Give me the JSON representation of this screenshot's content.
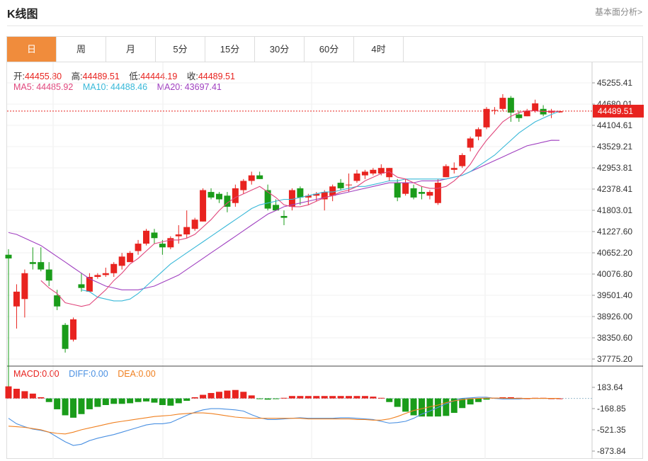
{
  "header": {
    "title": "K线图",
    "link": "基本面分析>"
  },
  "tabs": [
    {
      "label": "日",
      "active": true
    },
    {
      "label": "周",
      "active": false
    },
    {
      "label": "月",
      "active": false
    },
    {
      "label": "5分",
      "active": false
    },
    {
      "label": "15分",
      "active": false
    },
    {
      "label": "30分",
      "active": false
    },
    {
      "label": "60分",
      "active": false
    },
    {
      "label": "4时",
      "active": false
    }
  ],
  "ohlc_info": {
    "open_label": "开:",
    "open": "44455.80",
    "high_label": "高:",
    "high": "44489.51",
    "low_label": "低:",
    "low": "44444.19",
    "close_label": "收:",
    "close": "44489.51"
  },
  "ma_info": {
    "ma5_label": "MA5:",
    "ma5": "44485.92",
    "ma10_label": "MA10:",
    "ma10": "44488.46",
    "ma20_label": "MA20:",
    "ma20": "43697.41"
  },
  "macd_info": {
    "macd_label": "MACD:",
    "macd": "0.00",
    "diff_label": "DIFF:",
    "diff": "0.00",
    "dea_label": "DEA:",
    "dea": "0.00"
  },
  "current_price_tag": "44489.51",
  "colors": {
    "up": "#e8231f",
    "down": "#1a9c1a",
    "ma5": "#e0467c",
    "ma10": "#38b8d8",
    "ma20": "#a040c0",
    "dea": "#f08020",
    "diff": "#4a90e2",
    "accent": "#f08c3c"
  },
  "chart_data": {
    "type": "candlestick",
    "y_ticks": [
      "45255.41",
      "44680.01",
      "44104.61",
      "43529.21",
      "42953.81",
      "42378.41",
      "41803.01",
      "41227.60",
      "40652.20",
      "40076.80",
      "39501.40",
      "38926.00",
      "38350.60",
      "37775.20"
    ],
    "ylim": [
      37775.2,
      45255.41
    ],
    "candles": [
      {
        "o": 40600,
        "h": 40750,
        "l": 37000,
        "c": 40500
      },
      {
        "o": 39200,
        "h": 39800,
        "l": 38600,
        "c": 39600
      },
      {
        "o": 39400,
        "h": 40200,
        "l": 38900,
        "c": 40100
      },
      {
        "o": 40400,
        "h": 40800,
        "l": 40200,
        "c": 40350
      },
      {
        "o": 40400,
        "h": 40800,
        "l": 40150,
        "c": 40200
      },
      {
        "o": 40200,
        "h": 40400,
        "l": 39750,
        "c": 39900
      },
      {
        "o": 39500,
        "h": 39650,
        "l": 39100,
        "c": 39200
      },
      {
        "o": 38700,
        "h": 38750,
        "l": 37950,
        "c": 38050
      },
      {
        "o": 38300,
        "h": 38900,
        "l": 38250,
        "c": 38850
      },
      {
        "o": 39800,
        "h": 40100,
        "l": 39600,
        "c": 39700
      },
      {
        "o": 39600,
        "h": 40100,
        "l": 39600,
        "c": 40000
      },
      {
        "o": 40000,
        "h": 40100,
        "l": 39950,
        "c": 40050
      },
      {
        "o": 40050,
        "h": 40250,
        "l": 40000,
        "c": 40100
      },
      {
        "o": 40100,
        "h": 40400,
        "l": 40000,
        "c": 40350
      },
      {
        "o": 40300,
        "h": 40650,
        "l": 40200,
        "c": 40550
      },
      {
        "o": 40400,
        "h": 40700,
        "l": 40400,
        "c": 40650
      },
      {
        "o": 40700,
        "h": 41000,
        "l": 40600,
        "c": 40900
      },
      {
        "o": 40900,
        "h": 41300,
        "l": 40850,
        "c": 41250
      },
      {
        "o": 41200,
        "h": 41300,
        "l": 40900,
        "c": 41050
      },
      {
        "o": 40900,
        "h": 41000,
        "l": 40600,
        "c": 40800
      },
      {
        "o": 40800,
        "h": 41100,
        "l": 40750,
        "c": 41050
      },
      {
        "o": 41100,
        "h": 41400,
        "l": 40900,
        "c": 41150
      },
      {
        "o": 41150,
        "h": 41800,
        "l": 41050,
        "c": 41350
      },
      {
        "o": 41300,
        "h": 41600,
        "l": 41250,
        "c": 41550
      },
      {
        "o": 41500,
        "h": 42400,
        "l": 41500,
        "c": 42350
      },
      {
        "o": 42300,
        "h": 42400,
        "l": 42100,
        "c": 42150
      },
      {
        "o": 42250,
        "h": 42300,
        "l": 42000,
        "c": 42100
      },
      {
        "o": 42200,
        "h": 42300,
        "l": 41750,
        "c": 41900
      },
      {
        "o": 42000,
        "h": 42500,
        "l": 41900,
        "c": 42400
      },
      {
        "o": 42350,
        "h": 42650,
        "l": 42250,
        "c": 42600
      },
      {
        "o": 42600,
        "h": 42850,
        "l": 42500,
        "c": 42750
      },
      {
        "o": 42750,
        "h": 42850,
        "l": 42650,
        "c": 42650
      },
      {
        "o": 42350,
        "h": 42500,
        "l": 41800,
        "c": 41850
      },
      {
        "o": 41950,
        "h": 42100,
        "l": 41800,
        "c": 41800
      },
      {
        "o": 41650,
        "h": 41800,
        "l": 41400,
        "c": 41600
      },
      {
        "o": 41900,
        "h": 42400,
        "l": 41800,
        "c": 42350
      },
      {
        "o": 42400,
        "h": 42450,
        "l": 41950,
        "c": 42150
      },
      {
        "o": 42150,
        "h": 42250,
        "l": 41950,
        "c": 42200
      },
      {
        "o": 42200,
        "h": 42300,
        "l": 42050,
        "c": 42250
      },
      {
        "o": 42100,
        "h": 42350,
        "l": 41800,
        "c": 42300
      },
      {
        "o": 42200,
        "h": 42500,
        "l": 42050,
        "c": 42450
      },
      {
        "o": 42550,
        "h": 42650,
        "l": 42350,
        "c": 42400
      },
      {
        "o": 42500,
        "h": 42800,
        "l": 42300,
        "c": 42500
      },
      {
        "o": 42600,
        "h": 42900,
        "l": 42550,
        "c": 42800
      },
      {
        "o": 42750,
        "h": 42900,
        "l": 42650,
        "c": 42850
      },
      {
        "o": 42800,
        "h": 42950,
        "l": 42750,
        "c": 42900
      },
      {
        "o": 42800,
        "h": 43050,
        "l": 42750,
        "c": 42950
      },
      {
        "o": 42700,
        "h": 42950,
        "l": 42600,
        "c": 42950
      },
      {
        "o": 42550,
        "h": 42650,
        "l": 42050,
        "c": 42150
      },
      {
        "o": 42250,
        "h": 42650,
        "l": 42200,
        "c": 42550
      },
      {
        "o": 42400,
        "h": 42500,
        "l": 42100,
        "c": 42150
      },
      {
        "o": 42300,
        "h": 42450,
        "l": 42100,
        "c": 42250
      },
      {
        "o": 42200,
        "h": 42350,
        "l": 42100,
        "c": 42300
      },
      {
        "o": 42000,
        "h": 42650,
        "l": 41950,
        "c": 42550
      },
      {
        "o": 42700,
        "h": 43050,
        "l": 42700,
        "c": 43000
      },
      {
        "o": 42900,
        "h": 43100,
        "l": 42800,
        "c": 42950
      },
      {
        "o": 43000,
        "h": 43350,
        "l": 42950,
        "c": 43300
      },
      {
        "o": 43500,
        "h": 43800,
        "l": 43400,
        "c": 43750
      },
      {
        "o": 43800,
        "h": 44050,
        "l": 43700,
        "c": 44000
      },
      {
        "o": 44050,
        "h": 44600,
        "l": 44000,
        "c": 44550
      },
      {
        "o": 44500,
        "h": 44600,
        "l": 44400,
        "c": 44520
      },
      {
        "o": 44550,
        "h": 44950,
        "l": 44500,
        "c": 44850
      },
      {
        "o": 44850,
        "h": 44900,
        "l": 44200,
        "c": 44450
      },
      {
        "o": 44400,
        "h": 44500,
        "l": 44200,
        "c": 44300
      },
      {
        "o": 44350,
        "h": 44550,
        "l": 44350,
        "c": 44500
      },
      {
        "o": 44500,
        "h": 44800,
        "l": 44450,
        "c": 44700
      },
      {
        "o": 44550,
        "h": 44650,
        "l": 44350,
        "c": 44400
      },
      {
        "o": 44450,
        "h": 44550,
        "l": 44300,
        "c": 44500
      },
      {
        "o": 44455.8,
        "h": 44489.51,
        "l": 44444.19,
        "c": 44489.51
      }
    ],
    "ma5": [
      null,
      null,
      null,
      null,
      39900,
      39700,
      39550,
      39300,
      39250,
      39200,
      39250,
      39450,
      39650,
      39900,
      40100,
      40350,
      40500,
      40700,
      40900,
      40950,
      41000,
      41000,
      41050,
      41150,
      41350,
      41550,
      41800,
      42000,
      42150,
      42250,
      42350,
      42450,
      42300,
      42150,
      41950,
      41900,
      41900,
      41950,
      42050,
      42150,
      42200,
      42300,
      42350,
      42450,
      42600,
      42700,
      42800,
      42850,
      42700,
      42650,
      42550,
      42450,
      42400,
      42400,
      42450,
      42600,
      42800,
      43050,
      43400,
      43700,
      43950,
      44200,
      44350,
      44450,
      44500,
      44500,
      44480,
      44480,
      44485.92
    ],
    "ma10": [
      null,
      null,
      null,
      null,
      null,
      null,
      null,
      null,
      null,
      39650,
      39600,
      39450,
      39400,
      39350,
      39350,
      39400,
      39550,
      39750,
      39950,
      40150,
      40350,
      40500,
      40650,
      40800,
      40950,
      41100,
      41250,
      41400,
      41550,
      41700,
      41850,
      41950,
      42000,
      42050,
      42100,
      42100,
      42150,
      42200,
      42250,
      42300,
      42300,
      42350,
      42400,
      42450,
      42450,
      42500,
      42550,
      42600,
      42600,
      42650,
      42650,
      42650,
      42650,
      42650,
      42650,
      42700,
      42750,
      42850,
      43000,
      43150,
      43300,
      43500,
      43700,
      43900,
      44050,
      44200,
      44300,
      44400,
      44488.46
    ],
    "ma20": [
      41200,
      41150,
      41050,
      40950,
      40850,
      40700,
      40550,
      40400,
      40250,
      40100,
      39950,
      39850,
      39750,
      39700,
      39650,
      39650,
      39650,
      39700,
      39750,
      39850,
      39950,
      40050,
      40200,
      40350,
      40500,
      40650,
      40800,
      40950,
      41100,
      41250,
      41400,
      41550,
      41700,
      41800,
      41900,
      41950,
      42000,
      42050,
      42100,
      42150,
      42200,
      42250,
      42300,
      42350,
      42400,
      42450,
      42500,
      42550,
      42550,
      42550,
      42550,
      42600,
      42600,
      42600,
      42650,
      42700,
      42750,
      42850,
      42950,
      43050,
      43150,
      43250,
      43350,
      43450,
      43550,
      43600,
      43650,
      43700,
      43697.41
    ],
    "macd_ticks": [
      "183.64",
      "-168.85",
      "-521.35",
      "-873.84"
    ],
    "macd_ylim": [
      -873.84,
      183.64
    ],
    "macd_hist": [
      200,
      160,
      120,
      80,
      20,
      -60,
      -180,
      -280,
      -320,
      -260,
      -180,
      -140,
      -110,
      -90,
      -90,
      -80,
      -60,
      -50,
      -70,
      -110,
      -120,
      -80,
      -40,
      20,
      60,
      90,
      110,
      130,
      140,
      110,
      50,
      -10,
      -20,
      -10,
      10,
      40,
      40,
      40,
      40,
      40,
      40,
      40,
      40,
      40,
      40,
      30,
      10,
      -60,
      -140,
      -220,
      -280,
      -300,
      -300,
      -300,
      -290,
      -240,
      -160,
      -100,
      -60,
      -20,
      10,
      20,
      20,
      10,
      0,
      10,
      10,
      0,
      0
    ],
    "macd_diff": [
      -330,
      -420,
      -470,
      -510,
      -530,
      -560,
      -640,
      -720,
      -780,
      -760,
      -700,
      -660,
      -630,
      -600,
      -560,
      -520,
      -480,
      -440,
      -420,
      -420,
      -400,
      -340,
      -280,
      -230,
      -190,
      -170,
      -170,
      -180,
      -190,
      -210,
      -270,
      -320,
      -350,
      -350,
      -340,
      -330,
      -320,
      -330,
      -330,
      -330,
      -330,
      -320,
      -320,
      -330,
      -340,
      -350,
      -380,
      -410,
      -400,
      -380,
      -330,
      -260,
      -210,
      -150,
      -90,
      -40,
      0,
      10,
      20,
      20,
      0,
      -10,
      -10,
      -10,
      0,
      0,
      0,
      0,
      0
    ],
    "macd_dea": [
      -460,
      -470,
      -480,
      -500,
      -520,
      -560,
      -580,
      -590,
      -560,
      -520,
      -490,
      -460,
      -430,
      -400,
      -380,
      -360,
      -340,
      -320,
      -300,
      -290,
      -280,
      -260,
      -250,
      -240,
      -240,
      -250,
      -270,
      -290,
      -310,
      -320,
      -330,
      -330,
      -330,
      -330,
      -330,
      -330,
      -330,
      -340,
      -340,
      -340,
      -340,
      -340,
      -340,
      -350,
      -350,
      -360,
      -360,
      -340,
      -300,
      -250,
      -200,
      -170,
      -140,
      -110,
      -70,
      -40,
      -20,
      -5,
      0,
      5,
      5,
      5,
      0,
      0,
      0,
      0,
      0,
      0,
      0
    ]
  }
}
